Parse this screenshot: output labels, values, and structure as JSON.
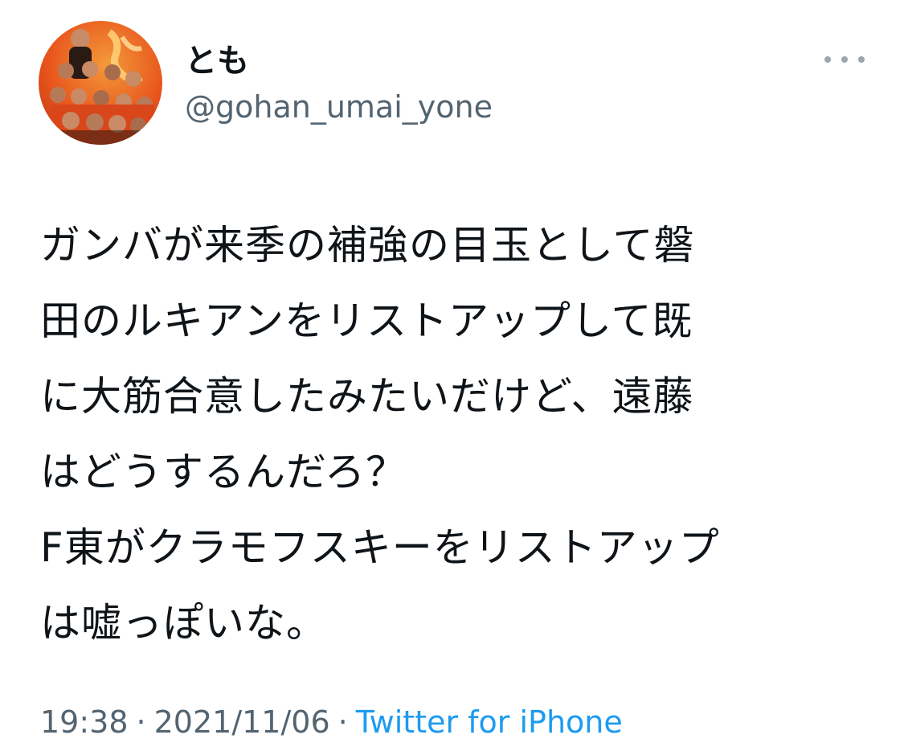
{
  "author": {
    "display_name": "とも",
    "handle": "@gohan_umai_yone",
    "avatar_icon": "profile-photo-team-players",
    "avatar_colors": [
      "#e8541c",
      "#f39a3a",
      "#2a1a14"
    ]
  },
  "more_icon": "more-horizontal-icon",
  "tweet": {
    "lines": [
      "ガンバが来季の補強の目玉として磐",
      "田のルキアンをリストアップして既",
      "に大筋合意したみたいだけど、遠藤",
      "はどうするんだろ？",
      "F東がクラモフスキーをリストアップ",
      "は嘘っぽいな。"
    ]
  },
  "meta": {
    "time": "19:38",
    "separator": "·",
    "date": "2021/11/06",
    "source": "Twitter for iPhone"
  },
  "colors": {
    "text": "#0f1419",
    "secondary": "#536471",
    "link": "#1d9bf0"
  }
}
